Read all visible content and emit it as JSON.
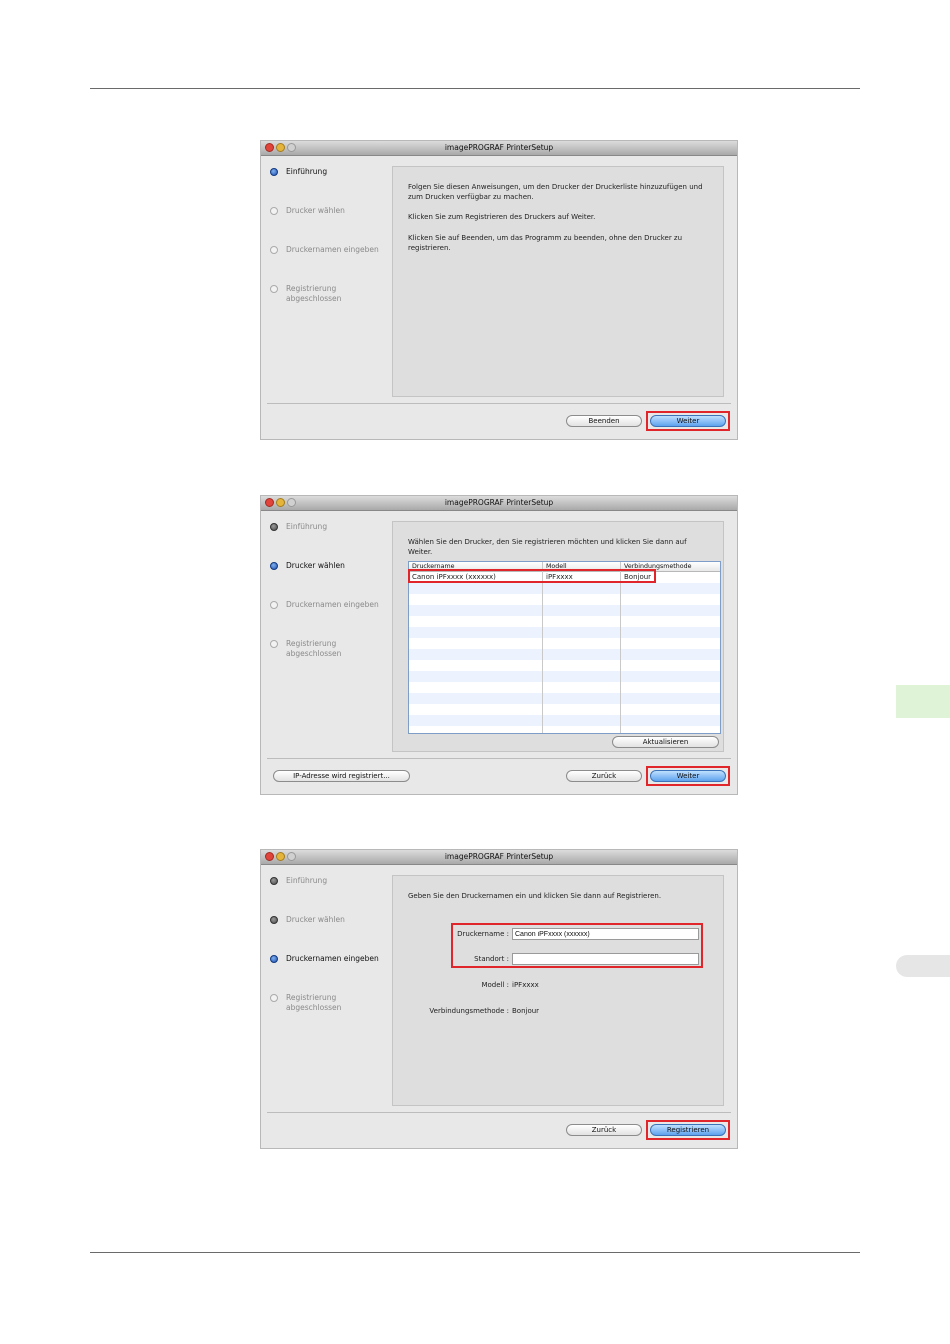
{
  "app_title": "imagePROGRAF PrinterSetup",
  "steps": [
    "Einführung",
    "Drucker wählen",
    "Druckernamen eingeben",
    "Registrierung\nabgeschlossen"
  ],
  "dialog1": {
    "paragraphs": [
      "Folgen Sie diesen Anweisungen, um den Drucker der Druckerliste hinzuzufügen und zum Drucken verfügbar zu machen.",
      "Klicken Sie zum Registrieren des Druckers auf Weiter.",
      "Klicken Sie auf Beenden, um das Programm zu beenden, ohne den Drucker zu registrieren."
    ],
    "buttons": {
      "quit": "Beenden",
      "next": "Weiter"
    }
  },
  "dialog2": {
    "instruction": "Wählen Sie den Drucker, den Sie registrieren möchten und klicken Sie dann auf Weiter.",
    "table": {
      "columns": [
        "Druckername",
        "Modell",
        "Verbindungsmethode"
      ],
      "rows": [
        [
          "Canon iPFxxxx (xxxxxx)",
          "iPFxxxx",
          "Bonjour"
        ]
      ]
    },
    "buttons": {
      "refresh": "Aktualisieren",
      "ip": "IP-Adresse wird registriert...",
      "back": "Zurück",
      "next": "Weiter"
    }
  },
  "dialog3": {
    "instruction": "Geben Sie den Druckernamen ein und klicken Sie dann auf Registrieren.",
    "fields": {
      "printer_name_label": "Druckername :",
      "printer_name_value": "Canon iPFxxxx (xxxxxx)",
      "location_label": "Standort :",
      "location_value": "",
      "model_label": "Modell :",
      "model_value": "iPFxxxx",
      "method_label": "Verbindungsmethode :",
      "method_value": "Bonjour"
    },
    "buttons": {
      "back": "Zurück",
      "register": "Registrieren"
    }
  },
  "colors": {
    "highlight": "#e0262a",
    "accent": "#5fa2ee",
    "side_tab": "#dff3d6"
  }
}
